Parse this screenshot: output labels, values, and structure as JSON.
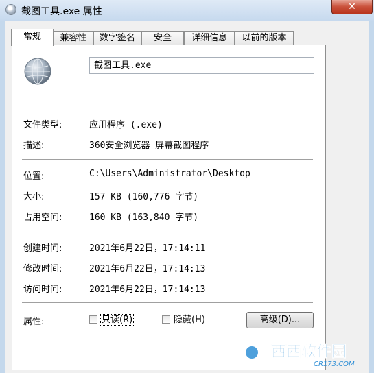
{
  "window": {
    "title": "截图工具.exe 属性",
    "close_glyph": "✕"
  },
  "tabs": [
    {
      "label": "常规",
      "active": true
    },
    {
      "label": "兼容性",
      "active": false
    },
    {
      "label": "数字签名",
      "active": false
    },
    {
      "label": "安全",
      "active": false
    },
    {
      "label": "详细信息",
      "active": false
    },
    {
      "label": "以前的版本",
      "active": false
    }
  ],
  "general": {
    "file_name": "截图工具.exe",
    "file_type": {
      "label": "文件类型:",
      "value": "应用程序 (.exe)"
    },
    "description": {
      "label": "描述:",
      "value": "360安全浏览器 屏幕截图程序"
    },
    "location": {
      "label": "位置:",
      "value": "C:\\Users\\Administrator\\Desktop"
    },
    "size": {
      "label": "大小:",
      "value": "157 KB (160,776 字节)"
    },
    "size_on_disk": {
      "label": "占用空间:",
      "value": "160 KB (163,840 字节)"
    },
    "created": {
      "label": "创建时间:",
      "value": "2021年6月22日，17:14:11"
    },
    "modified": {
      "label": "修改时间:",
      "value": "2021年6月22日，17:14:13"
    },
    "accessed": {
      "label": "访问时间:",
      "value": "2021年6月22日，17:14:13"
    },
    "attributes": {
      "label": "属性:",
      "readonly_label": "只读(R)",
      "readonly_checked": false,
      "hidden_label": "隐藏(H)",
      "hidden_checked": false,
      "advanced_button": "高级(D)..."
    }
  },
  "watermark": {
    "brand": "西西软件园",
    "domain": "CR173.COM"
  },
  "colors": {
    "title_gradient_top": "#dfeaf6",
    "close_red": "#c9503a",
    "panel_bg": "#ffffff",
    "dialog_bg": "#f0f0f0"
  }
}
